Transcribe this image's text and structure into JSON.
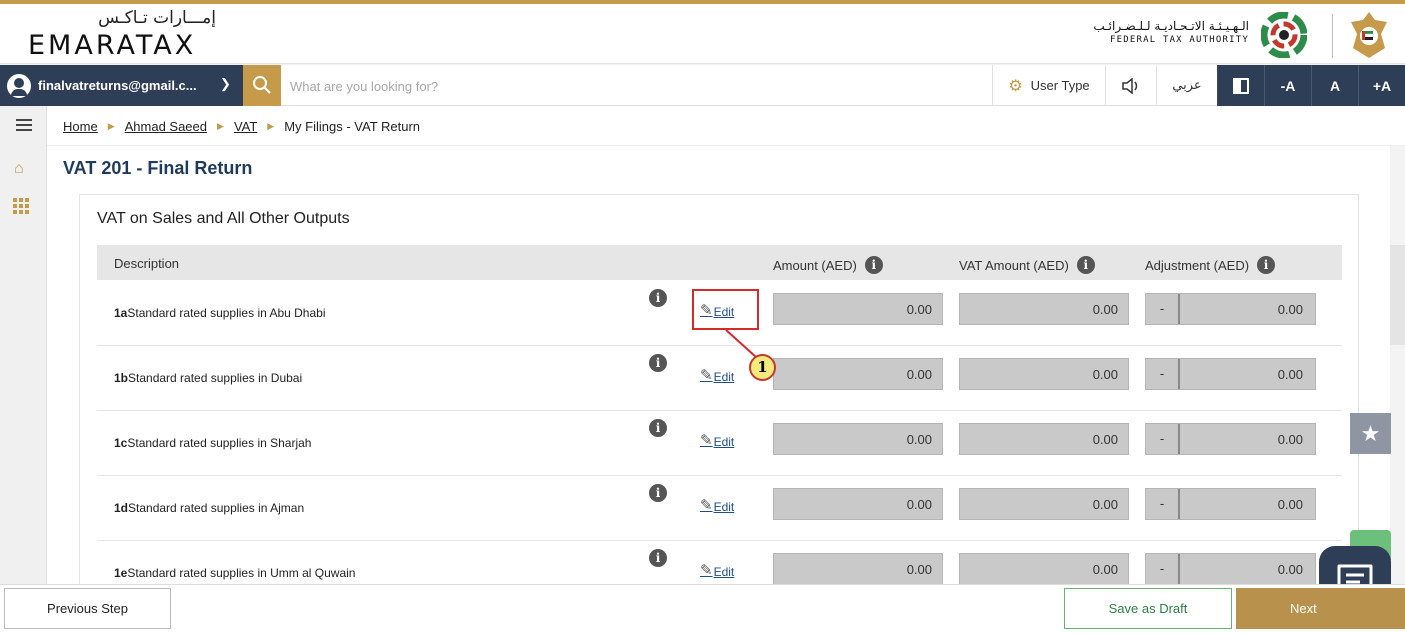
{
  "header": {
    "logo_ar": "إمـــارات تـاكـس",
    "logo_en": "EMARATAX",
    "authority_ar": "الـهـيـئـة الاتـحـاديـة لـلـضـرائـب",
    "authority_en": "FEDERAL TAX AUTHORITY"
  },
  "toolbar": {
    "account_email": "finalvatreturns@gmail.c...",
    "search_placeholder": "What are you looking for?",
    "user_type": "User Type",
    "arabic_label": "عربي",
    "font_decrease": "-A",
    "font_normal": "A",
    "font_increase": "+A"
  },
  "breadcrumb": {
    "items": [
      "Home",
      "Ahmad Saeed",
      "VAT"
    ],
    "current": "My Filings - VAT Return"
  },
  "page": {
    "title": "VAT 201 - Final Return",
    "section_title": "VAT on Sales and All Other Outputs"
  },
  "table": {
    "headers": {
      "description": "Description",
      "amount": "Amount (AED)",
      "vat_amount": "VAT Amount (AED)",
      "adjustment": "Adjustment (AED)"
    },
    "edit_label": "Edit",
    "rows": [
      {
        "code": "1a",
        "label": "Standard rated supplies in Abu Dhabi",
        "amount": "0.00",
        "vat": "0.00",
        "adj_sign": "-",
        "adjustment": "0.00"
      },
      {
        "code": "1b",
        "label": "Standard rated supplies in Dubai",
        "amount": "0.00",
        "vat": "0.00",
        "adj_sign": "-",
        "adjustment": "0.00"
      },
      {
        "code": "1c",
        "label": "Standard rated supplies in Sharjah",
        "amount": "0.00",
        "vat": "0.00",
        "adj_sign": "-",
        "adjustment": "0.00"
      },
      {
        "code": "1d",
        "label": "Standard rated supplies in Ajman",
        "amount": "0.00",
        "vat": "0.00",
        "adj_sign": "-",
        "adjustment": "0.00"
      },
      {
        "code": "1e",
        "label": "Standard rated supplies in Umm al Quwain",
        "amount": "0.00",
        "vat": "0.00",
        "adj_sign": "-",
        "adjustment": "0.00"
      }
    ]
  },
  "annotation": {
    "badge": "1",
    "color": "#d42a2a"
  },
  "footer": {
    "previous": "Previous Step",
    "save_draft": "Save as Draft",
    "next": "Next"
  },
  "colors": {
    "accent": "#c59a4b",
    "navy": "#2f3e57",
    "title": "#1e3a5c"
  }
}
